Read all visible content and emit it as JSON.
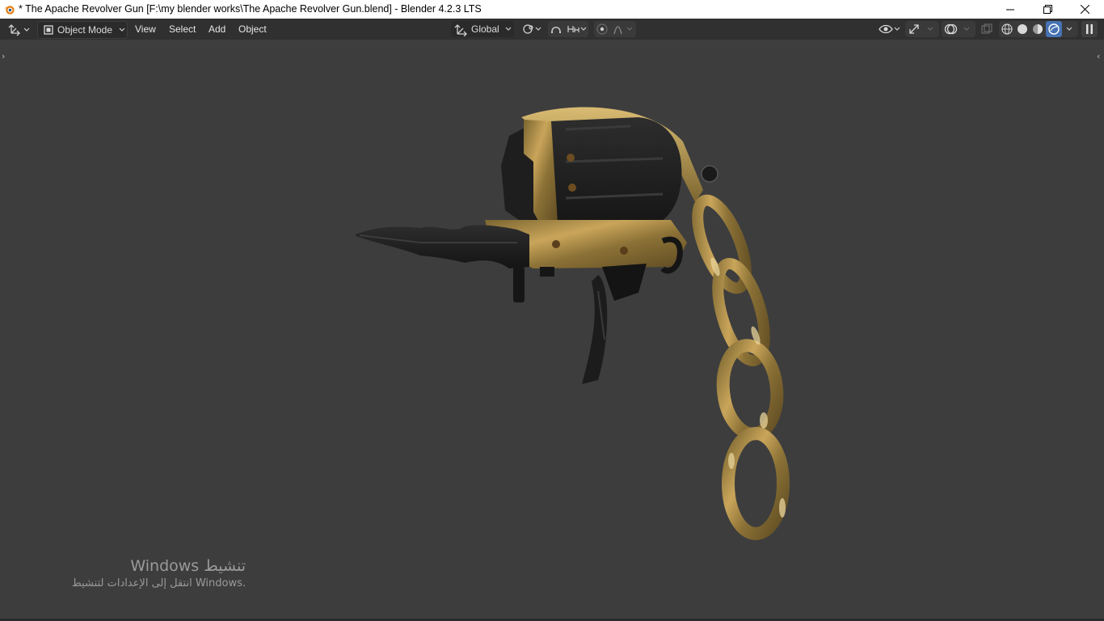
{
  "window": {
    "title": "* The Apache Revolver Gun [F:\\my blender works\\The Apache Revolver Gun.blend] - Blender 4.2.3 LTS",
    "controls": [
      "minimize-icon",
      "restore-icon",
      "close-icon"
    ]
  },
  "header": {
    "editor_type_icon": "viewport-gizmo-icon",
    "mode_label": "Object Mode",
    "menus": [
      "View",
      "Select",
      "Add",
      "Object"
    ],
    "transform_orientation": "Global",
    "pivot_icon": "pivot-icon",
    "snap_icon": "snap-icon",
    "snap_target_icon": "snap-increment-icon",
    "proportional_icon": "proportional-edit-icon",
    "falloff_icon": "falloff-curve-icon",
    "visibility_icon": "eye-icon",
    "gizmo_icon": "gizmo-icon",
    "overlay_icon": "overlay-icon",
    "xray_icon": "xray-icon",
    "shading_modes": [
      "wireframe",
      "solid",
      "material-preview",
      "rendered"
    ],
    "active_shading": "rendered",
    "accent_color": "#4772b3"
  },
  "watermark": {
    "line1": "Windows تنشيط",
    "line2": "انتقل إلى الإعدادات لتنشيط Windows."
  }
}
